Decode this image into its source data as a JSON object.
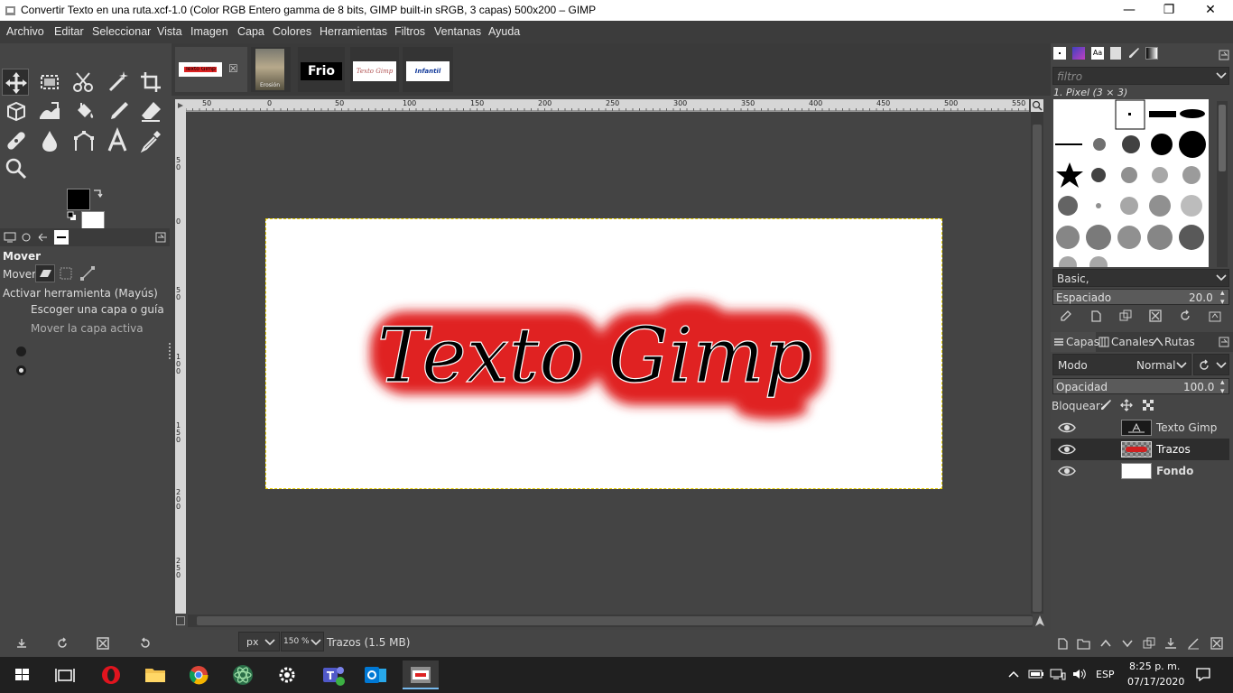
{
  "window": {
    "title": "Convertir Texto en una ruta.xcf-1.0 (Color RGB Entero gamma de 8 bits, GIMP built-in sRGB, 3 capas) 500x200 – GIMP",
    "controls": {
      "minimize": "—",
      "maximize": "❐",
      "close": "✕"
    }
  },
  "menubar": {
    "items": [
      "Archivo",
      "Editar",
      "Seleccionar",
      "Vista",
      "Imagen",
      "Capa",
      "Colores",
      "Herramientas",
      "Filtros",
      "Ventanas",
      "Ayuda"
    ]
  },
  "toolbox": {
    "tools": [
      "move-icon",
      "rect-select-icon",
      "scissors-icon",
      "fuzzy-select-icon",
      "crop-icon",
      "3d-transform-icon",
      "warp-icon",
      "bucket-fill-icon",
      "paintbrush-icon",
      "eraser-icon",
      "heal-icon",
      "smudge-icon",
      "path-icon",
      "text-icon",
      "color-picker-icon",
      "zoom-icon"
    ],
    "colors": {
      "foreground": "#000000",
      "background": "#ffffff"
    }
  },
  "tool_options": {
    "title": "Mover",
    "mover_label": "Mover:",
    "activar_label": "Activar herramienta  (Mayús)",
    "radio_options": [
      {
        "label": "Escoger una capa o guía",
        "checked": false
      },
      {
        "label": "Mover la capa activa",
        "checked": true
      }
    ]
  },
  "image_tabs": [
    {
      "label": "Texto Gimp",
      "active": true
    },
    {
      "label": "Erosión",
      "active": false
    },
    {
      "label": "Frio",
      "active": false
    },
    {
      "label": "Texto Gimp",
      "active": false
    },
    {
      "label": "Infantil",
      "active": false
    }
  ],
  "ruler": {
    "top_ticks": [
      "50",
      "0",
      "50",
      "100",
      "150",
      "200",
      "250",
      "300",
      "350",
      "400",
      "450",
      "500",
      "550"
    ],
    "left_ticks": [
      "5\n0",
      "0",
      "5\n0",
      "1\n0\n0",
      "1\n5\n0",
      "2\n0\n0",
      "2\n5\n0"
    ]
  },
  "canvas": {
    "text": "Texto Gimp",
    "glow_color": "#e02020"
  },
  "status": {
    "unit": "px",
    "zoom": "150 %",
    "info": "Trazos (1.5 MB)"
  },
  "brushes": {
    "filter_placeholder": "filtro",
    "selected_brush": "1. Pixel (3 × 3)",
    "preset": "Basic,",
    "spacing_label": "Espaciado",
    "spacing_value": "20.0"
  },
  "layers_panel": {
    "tabs": [
      "Capas",
      "Canales",
      "Rutas"
    ],
    "mode_label": "Modo",
    "mode_value": "Normal",
    "opacity_label": "Opacidad",
    "opacity_value": "100.0",
    "lock_label": "Bloquear:",
    "layers": [
      {
        "name": "Texto Gimp",
        "visible": true,
        "active": false
      },
      {
        "name": "Trazos",
        "visible": true,
        "active": true
      },
      {
        "name": "Fondo",
        "visible": true,
        "active": false
      }
    ]
  },
  "taskbar": {
    "apps": [
      "windows-start-icon",
      "task-view-icon",
      "opera-icon",
      "file-explorer-icon",
      "chrome-icon",
      "atom-icon",
      "settings-icon",
      "teams-icon",
      "outlook-icon",
      "gimp-icon"
    ],
    "language": "ESP",
    "time": "8:25 p. m.",
    "date": "07/17/2020"
  }
}
